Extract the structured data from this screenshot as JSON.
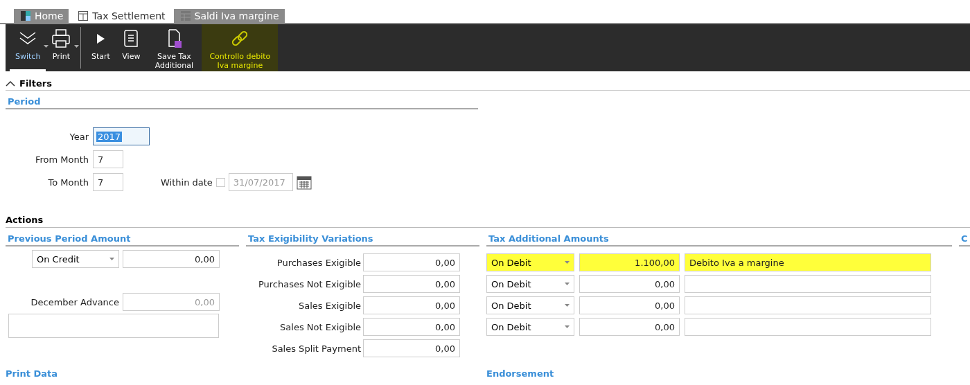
{
  "tabs": [
    {
      "label": "Home",
      "selected": false,
      "kind": "home"
    },
    {
      "label": "Tax Settlement",
      "selected": true,
      "kind": "form"
    },
    {
      "label": "Saldi Iva margine",
      "selected": false,
      "kind": "table"
    }
  ],
  "toolbar": [
    {
      "label": "Switch",
      "kind": "switch",
      "selected": true,
      "dropdown": true,
      "highlighted": false
    },
    {
      "label": "Print",
      "kind": "print",
      "selected": false,
      "dropdown": true,
      "highlighted": false
    },
    {
      "label": "Start",
      "kind": "play",
      "selected": false,
      "dropdown": false,
      "highlighted": false
    },
    {
      "label": "View",
      "kind": "scroll",
      "selected": false,
      "dropdown": false,
      "highlighted": false
    },
    {
      "label": "Save Tax Additional",
      "kind": "save",
      "selected": false,
      "dropdown": false,
      "highlighted": false
    },
    {
      "label": "Controllo debito Iva margine",
      "kind": "link",
      "selected": false,
      "dropdown": false,
      "highlighted": true
    }
  ],
  "filters": {
    "title": "Filters",
    "expanded": true,
    "period": {
      "title": "Period",
      "year_label": "Year",
      "year": "2017",
      "from_label": "From Month",
      "from": "7",
      "to_label": "To Month",
      "to": "7",
      "within_label": "Within date",
      "within_checked": false,
      "date": "31/07/2017"
    }
  },
  "actions": {
    "title": "Actions",
    "previous": {
      "title": "Previous Period Amount",
      "type": "On Credit",
      "amount": "0,00",
      "december_label": "December Advance",
      "december": "0,00"
    },
    "exigibility": {
      "title": "Tax Exigibility Variations",
      "rows": [
        {
          "label": "Purchases Exigible",
          "value": "0,00"
        },
        {
          "label": "Purchases Not Exigible",
          "value": "0,00"
        },
        {
          "label": "Sales Exigible",
          "value": "0,00"
        },
        {
          "label": "Sales Not Exigible",
          "value": "0,00"
        },
        {
          "label": "Sales Split Payment",
          "value": "0,00"
        }
      ]
    },
    "additional": {
      "title": "Tax Additional Amounts",
      "rows": [
        {
          "type": "On Debit",
          "amount": "1.100,00",
          "note": "Debito Iva a margine",
          "highlighted": true
        },
        {
          "type": "On Debit",
          "amount": "0,00",
          "highlighted": false
        },
        {
          "type": "On Debit",
          "amount": "0,00",
          "highlighted": false
        },
        {
          "type": "On Debit",
          "amount": "0,00",
          "highlighted": false
        }
      ]
    },
    "column_4": {
      "title": "C"
    }
  },
  "print_data": {
    "title": "Print Data"
  },
  "endorsement": {
    "title": "Endorsement"
  }
}
